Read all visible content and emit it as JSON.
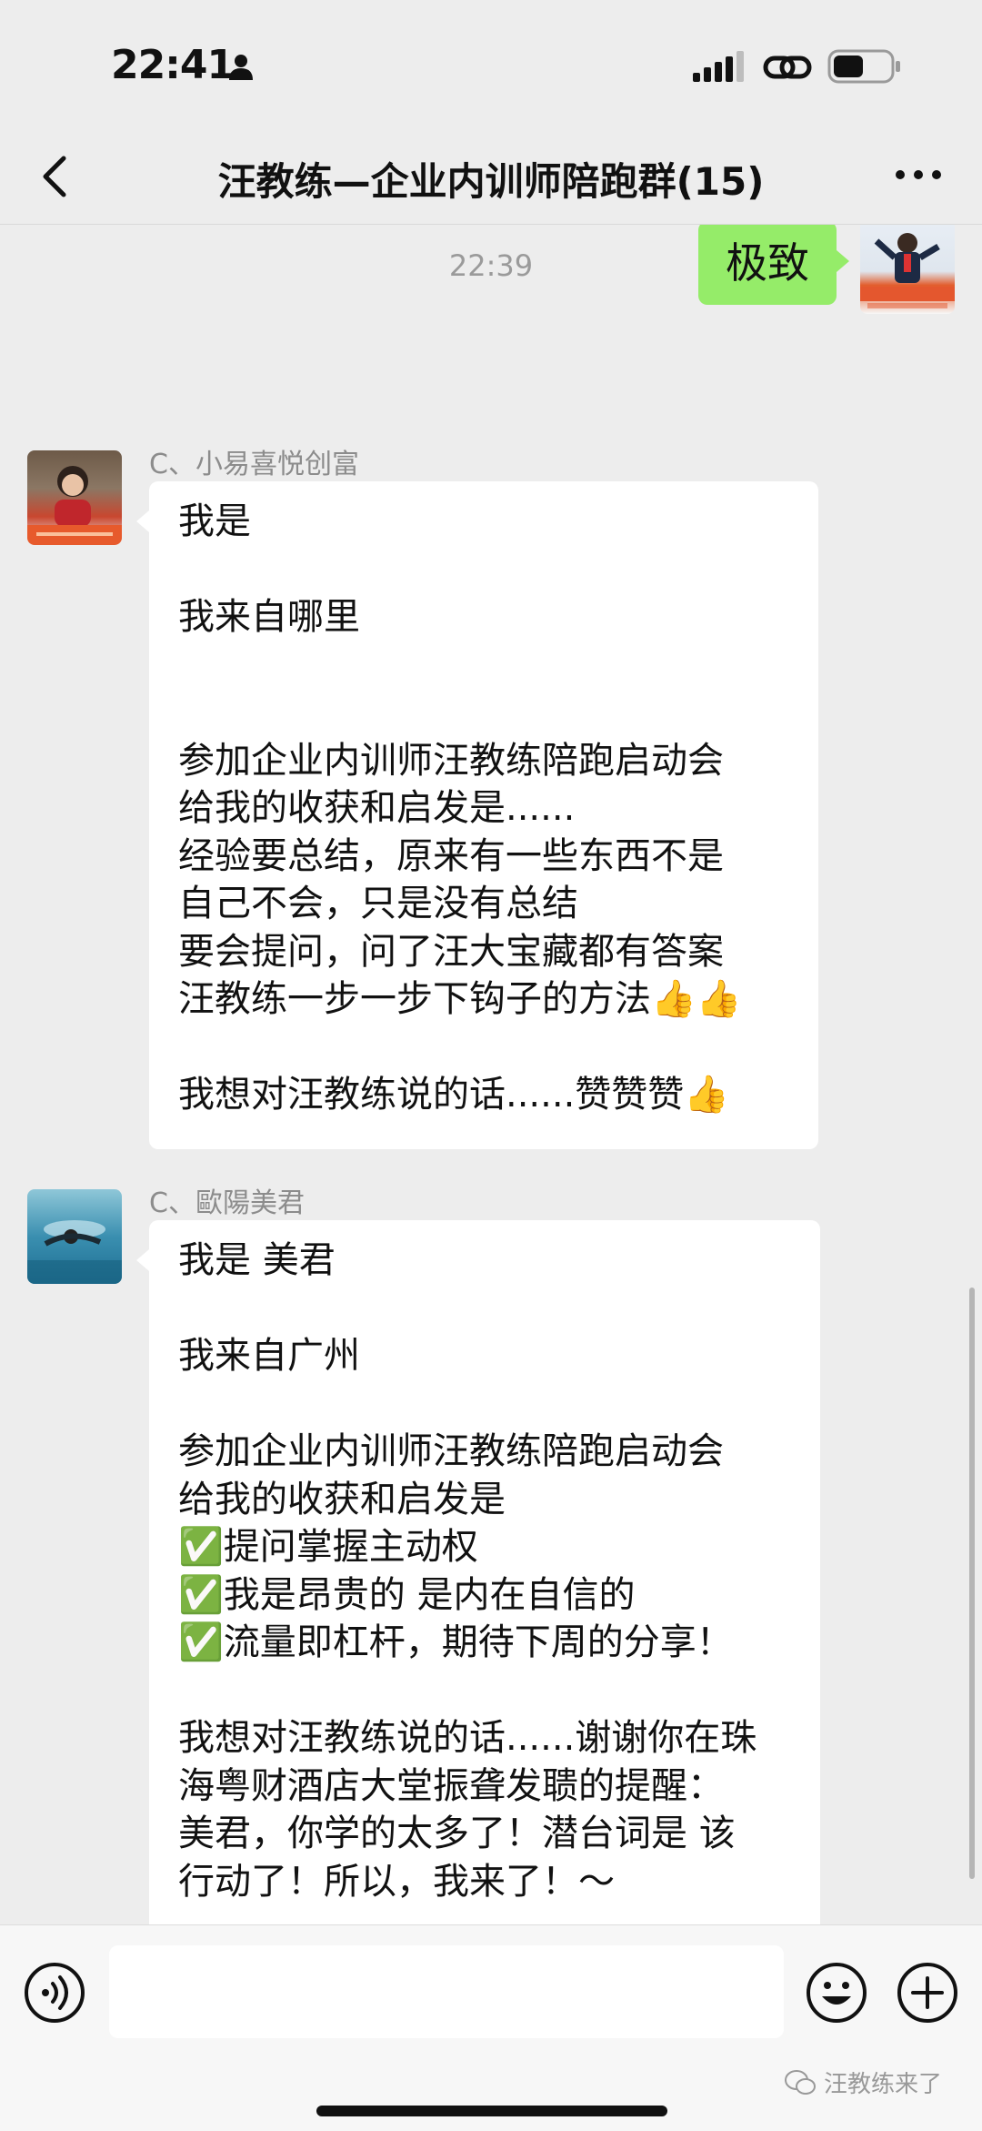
{
  "status": {
    "time": "22:41"
  },
  "nav": {
    "title": "汪教练—企业内训师陪跑群(15)"
  },
  "chat": {
    "self_message": "极致",
    "timestamp": "22:39",
    "messages": [
      {
        "sender": "C、小易喜悦创富",
        "text": "我是\n\n我来自哪里\n\n\n参加企业内训师汪教练陪跑启动会\n给我的收获和启发是......\n经验要总结，原来有一些东西不是\n自己不会，只是没有总结\n要会提问，问了汪大宝藏都有答案\n汪教练一步一步下钩子的方法👍👍\n\n我想对汪教练说的话......赞赞赞👍"
      },
      {
        "sender": "C、歐陽美君",
        "text": "我是 美君\n\n我来自广州\n\n参加企业内训师汪教练陪跑启动会\n给我的收获和启发是\n✅提问掌握主动权\n✅我是昂贵的 是内在自信的\n✅流量即杠杆，期待下周的分享！\n\n我想对汪教练说的话......谢谢你在珠\n海粤财酒店大堂振聋发聩的提醒：\n美君，你学的太多了！潜台词是 该\n行动了！所以，我来了！～"
      }
    ]
  },
  "watermark": {
    "text": "汪教练来了"
  },
  "icons": {
    "back": "chevron-left-icon",
    "more": "more-icon",
    "voice": "voice-icon",
    "emoji": "emoji-icon",
    "plus": "plus-icon"
  },
  "colors": {
    "self_bubble": "#95ec69",
    "other_bubble": "#ffffff",
    "background": "#ededed"
  }
}
